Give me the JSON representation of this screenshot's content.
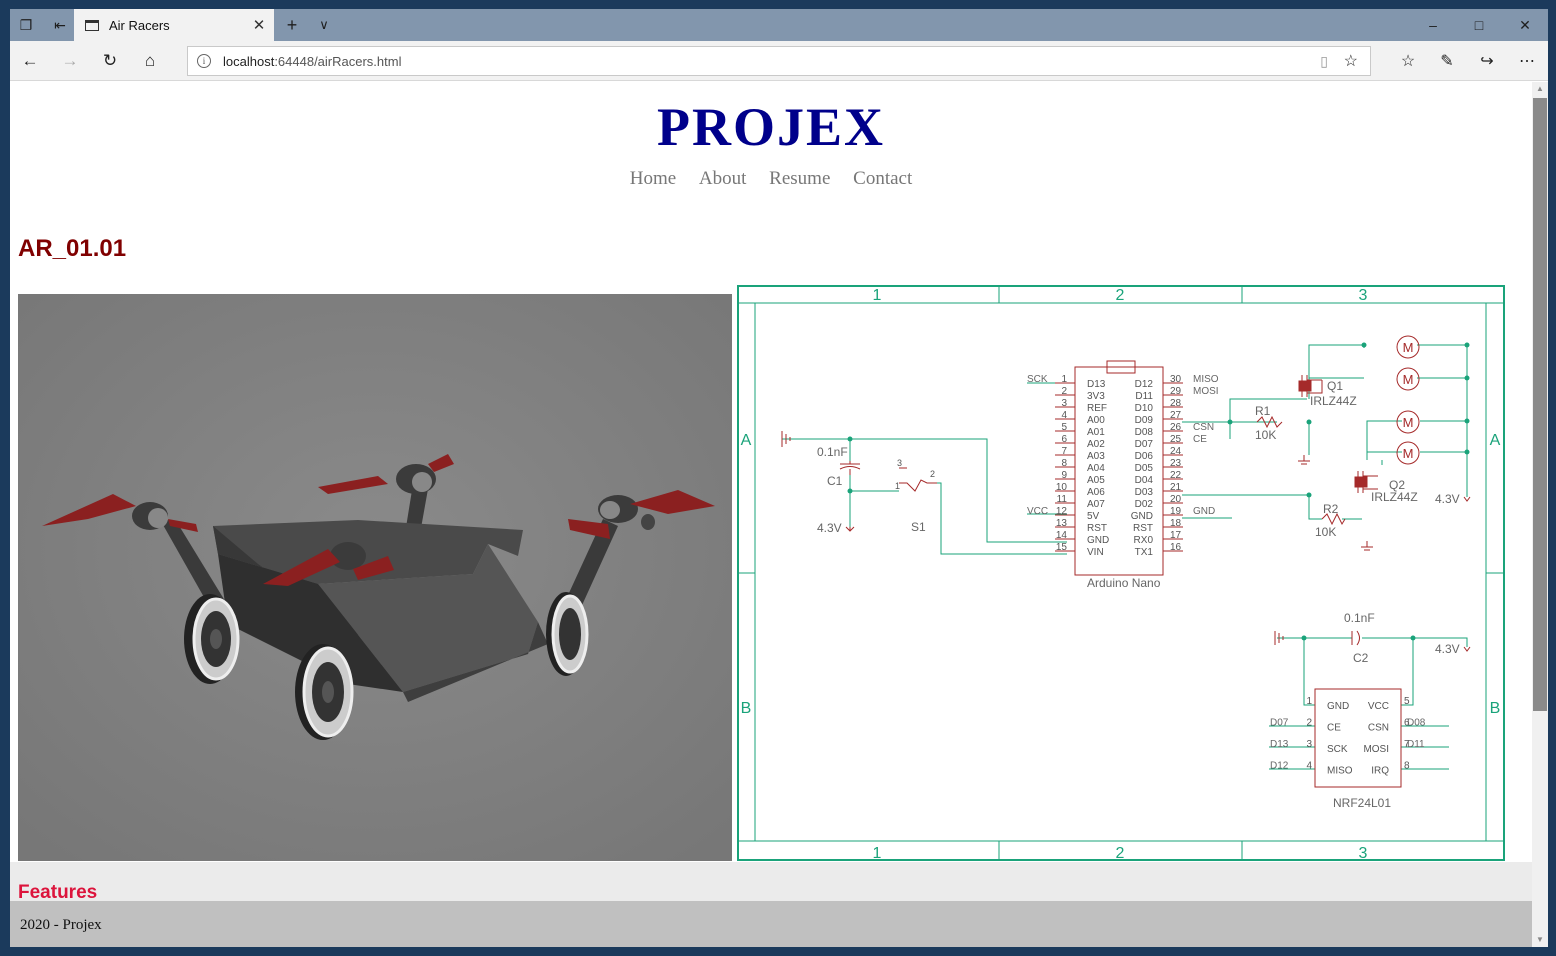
{
  "browser": {
    "tab_title": "Air Racers",
    "url_host": "localhost",
    "url_rest": ":64448/airRacers.html"
  },
  "site": {
    "logo": "PROJEX",
    "nav": [
      "Home",
      "About",
      "Resume",
      "Contact"
    ]
  },
  "content": {
    "heading": "AR_01.01",
    "features_heading": "Features"
  },
  "schematic": {
    "frame_cols": [
      "1",
      "2",
      "3"
    ],
    "frame_rows": [
      "A",
      "B"
    ],
    "arduino": {
      "name": "Arduino Nano",
      "left_pins": [
        [
          "D13",
          "1"
        ],
        [
          "3V3",
          "2"
        ],
        [
          "REF",
          "3"
        ],
        [
          "A00",
          "4"
        ],
        [
          "A01",
          "5"
        ],
        [
          "A02",
          "6"
        ],
        [
          "A03",
          "7"
        ],
        [
          "A04",
          "8"
        ],
        [
          "A05",
          "9"
        ],
        [
          "A06",
          "10"
        ],
        [
          "A07",
          "11"
        ],
        [
          "5V",
          "12"
        ],
        [
          "RST",
          "13"
        ],
        [
          "GND",
          "14"
        ],
        [
          "VIN",
          "15"
        ]
      ],
      "right_pins": [
        [
          "D12",
          "30"
        ],
        [
          "D11",
          "29"
        ],
        [
          "D10",
          "28"
        ],
        [
          "D09",
          "27"
        ],
        [
          "D08",
          "26"
        ],
        [
          "D07",
          "25"
        ],
        [
          "D06",
          "24"
        ],
        [
          "D05",
          "23"
        ],
        [
          "D04",
          "22"
        ],
        [
          "D03",
          "21"
        ],
        [
          "D02",
          "20"
        ],
        [
          "GND",
          "19"
        ],
        [
          "RST",
          "18"
        ],
        [
          "RX0",
          "17"
        ],
        [
          "TX1",
          "16"
        ]
      ],
      "left_nets": {
        "D13": "SCK",
        "5V": "VCC"
      },
      "right_nets": {
        "D12": "MISO",
        "D11": "MOSI",
        "D08": "CSN",
        "D07": "CE",
        "GND": "GND"
      }
    },
    "c1": {
      "name": "C1",
      "value": "0.1nF"
    },
    "c2": {
      "name": "C2",
      "value": "0.1nF"
    },
    "s1": "S1",
    "q1": {
      "name": "Q1",
      "part": "IRLZ44Z"
    },
    "q2": {
      "name": "Q2",
      "part": "IRLZ44Z"
    },
    "r1": {
      "name": "R1",
      "value": "10K"
    },
    "r2": {
      "name": "R2",
      "value": "10K"
    },
    "motor_label": "M",
    "supply": "4.3V",
    "switch_pins": [
      "3",
      "1",
      "2"
    ],
    "nrf": {
      "name": "NRF24L01",
      "left": [
        [
          "GND",
          "1",
          ""
        ],
        [
          "CE",
          "2",
          "D07"
        ],
        [
          "SCK",
          "3",
          "D13"
        ],
        [
          "MISO",
          "4",
          "D12"
        ]
      ],
      "right": [
        [
          "VCC",
          "5",
          ""
        ],
        [
          "CSN",
          "6",
          "D08"
        ],
        [
          "MOSI",
          "7",
          "D11"
        ],
        [
          "IRQ",
          "8",
          ""
        ]
      ]
    }
  },
  "footer": "2020 - Projex",
  "colors": {
    "logo": "#00008b",
    "heading": "#800000",
    "features": "#dc143c",
    "schematic_frame": "#1aa37a",
    "schematic_parts": "#a52a2a",
    "schematic_wire": "#1aa37a"
  }
}
